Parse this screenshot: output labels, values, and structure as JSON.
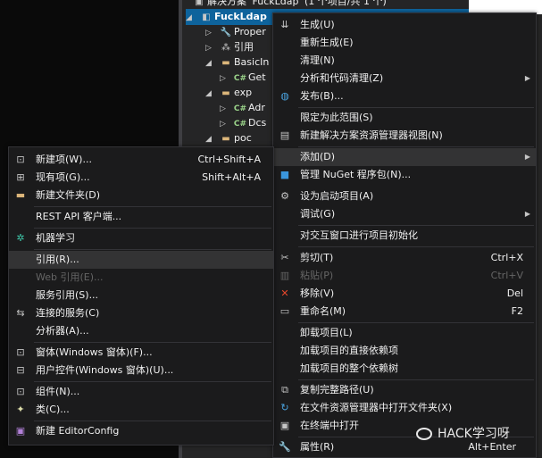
{
  "explorer": {
    "solution_label": "解决方案 'FuckLdap' (1 个项目/共 1 个)",
    "rows": [
      {
        "label": "FuckLdap",
        "icon": "csharp-project-icon",
        "selected": true
      },
      {
        "label": "Proper",
        "icon": "wrench-icon"
      },
      {
        "label": "引用",
        "icon": "references-icon"
      },
      {
        "label": "BasicIn",
        "icon": "folder-icon"
      },
      {
        "label": "Get",
        "icon": "csharp-file-icon"
      },
      {
        "label": "exp",
        "icon": "folder-icon"
      },
      {
        "label": "Adr",
        "icon": "csharp-file-icon"
      },
      {
        "label": "Dcs",
        "icon": "csharp-file-icon"
      },
      {
        "label": "poc",
        "icon": "folder-icon"
      }
    ]
  },
  "context_menu": {
    "items": [
      {
        "label": "生成(U)",
        "icon": "build-icon"
      },
      {
        "label": "重新生成(E)"
      },
      {
        "label": "清理(N)"
      },
      {
        "label": "分析和代码清理(Z)",
        "submenu": true
      },
      {
        "label": "发布(B)...",
        "icon": "globe-icon"
      },
      {
        "label": "限定为此范围(S)"
      },
      {
        "label": "新建解决方案资源管理器视图(N)",
        "icon": "new-view-icon"
      },
      {
        "label": "添加(D)",
        "submenu": true,
        "highlight": true
      },
      {
        "label": "管理 NuGet 程序包(N)...",
        "icon": "nuget-icon"
      },
      {
        "label": "设为启动项目(A)",
        "icon": "gear-icon"
      },
      {
        "label": "调试(G)",
        "submenu": true
      },
      {
        "label": "对交互窗口进行项目初始化"
      },
      {
        "label": "剪切(T)",
        "icon": "scissors-icon",
        "shortcut": "Ctrl+X"
      },
      {
        "label": "粘贴(P)",
        "icon": "paste-icon",
        "shortcut": "Ctrl+V",
        "disabled": true
      },
      {
        "label": "移除(V)",
        "icon": "remove-icon",
        "shortcut": "Del"
      },
      {
        "label": "重命名(M)",
        "icon": "rename-icon",
        "shortcut": "F2"
      },
      {
        "label": "卸载项目(L)"
      },
      {
        "label": "加载项目的直接依赖项"
      },
      {
        "label": "加载项目的整个依赖树"
      },
      {
        "label": "复制完整路径(U)",
        "icon": "copy-icon"
      },
      {
        "label": "在文件资源管理器中打开文件夹(X)",
        "icon": "refresh-icon"
      },
      {
        "label": "在终端中打开",
        "icon": "terminal-icon"
      },
      {
        "label": "属性(R)",
        "icon": "wrench-icon",
        "shortcut": "Alt+Enter"
      }
    ]
  },
  "add_submenu": {
    "items": [
      {
        "label": "新建项(W)...",
        "icon": "new-item-icon",
        "shortcut": "Ctrl+Shift+A"
      },
      {
        "label": "现有项(G)...",
        "icon": "existing-item-icon",
        "shortcut": "Shift+Alt+A"
      },
      {
        "label": "新建文件夹(D)",
        "icon": "new-folder-icon"
      },
      {
        "label": "REST API 客户端..."
      },
      {
        "label": "机器学习",
        "icon": "machine-learning-icon"
      },
      {
        "label": "引用(R)...",
        "highlight": true
      },
      {
        "label": "Web 引用(E)...",
        "disabled": true
      },
      {
        "label": "服务引用(S)..."
      },
      {
        "label": "连接的服务(C)",
        "icon": "connected-service-icon"
      },
      {
        "label": "分析器(A)..."
      },
      {
        "label": "窗体(Windows 窗体)(F)...",
        "icon": "form-icon"
      },
      {
        "label": "用户控件(Windows 窗体)(U)...",
        "icon": "user-control-icon"
      },
      {
        "label": "组件(N)...",
        "icon": "component-icon"
      },
      {
        "label": "类(C)...",
        "icon": "class-icon"
      },
      {
        "label": "新建 EditorConfig",
        "icon": "editorconfig-icon"
      }
    ]
  },
  "watermark": {
    "text": "HACK学习呀"
  }
}
